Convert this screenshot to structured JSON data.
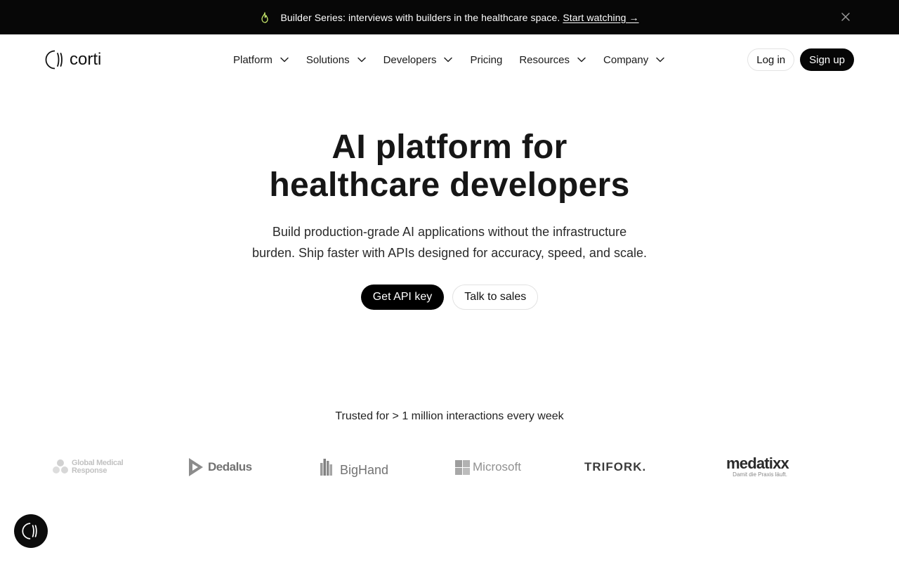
{
  "announcement": {
    "text": "Builder Series: interviews with builders in the healthcare space.",
    "link": "Start watching →",
    "icon": "flame-icon",
    "accent_color": "#c6e86b"
  },
  "brand": {
    "name": "corti"
  },
  "nav": {
    "items": [
      {
        "label": "Platform",
        "has_dropdown": true
      },
      {
        "label": "Solutions",
        "has_dropdown": true
      },
      {
        "label": "Developers",
        "has_dropdown": true
      },
      {
        "label": "Pricing",
        "has_dropdown": false
      },
      {
        "label": "Resources",
        "has_dropdown": true
      },
      {
        "label": "Company",
        "has_dropdown": true
      }
    ],
    "login": "Log in",
    "signup": "Sign up"
  },
  "hero": {
    "title_line1": "AI platform for",
    "title_line2": "healthcare developers",
    "subtitle_line1": "Build production-grade AI applications without the infrastructure",
    "subtitle_line2": "burden. Ship faster with APIs designed for accuracy, speed, and scale.",
    "primary_cta": "Get API key",
    "secondary_cta": "Talk to sales"
  },
  "trusted": {
    "text": "Trusted for > 1 million interactions every week",
    "logos": {
      "gmr_line1": "Global Medical",
      "gmr_line2": "Response",
      "dedalus": "Dedalus",
      "bighand": "BigHand",
      "microsoft": "Microsoft",
      "trifork": "TRIFORK.",
      "medatixx": "medatixx",
      "medatixx_tagline": "Damit die Praxis läuft."
    }
  },
  "chat": {
    "icon": "corti-chat-icon"
  }
}
